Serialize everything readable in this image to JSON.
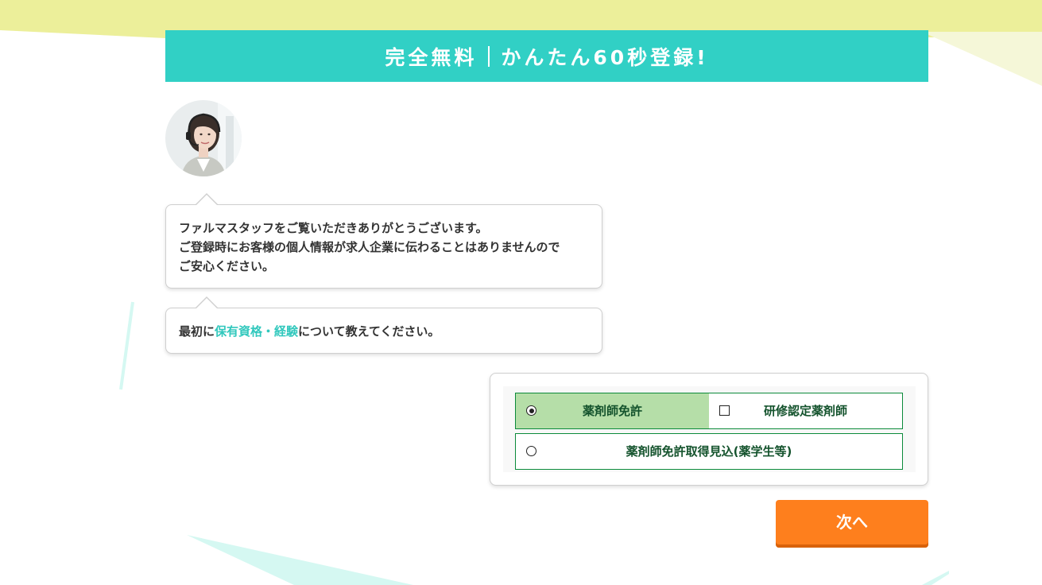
{
  "banner": {
    "part1": "完全無料",
    "part2": "かんたん60秒登録!"
  },
  "operator": {
    "avatar_alt": "オペレーター"
  },
  "messages": {
    "greeting_lines": [
      "ファルマスタッフをご覧いただきありがとうございます。",
      "ご登録時にお客様の個人情報が求人企業に伝わることはありませんので",
      "ご安心ください。"
    ],
    "question_prefix": "最初に",
    "question_highlight": "保有資格・経験",
    "question_suffix": "について教えてください。"
  },
  "options": {
    "license": {
      "label": "薬剤師免許",
      "type": "radio",
      "checked": true
    },
    "certified": {
      "label": "研修認定薬剤師",
      "type": "checkbox",
      "checked": false
    },
    "prospective": {
      "label": "薬剤師免許取得見込(薬学生等)",
      "type": "radio",
      "checked": false
    }
  },
  "next_button": {
    "label": "次へ"
  },
  "colors": {
    "banner": "#31d0c5",
    "highlight": "#31c8bd",
    "selected_option": "#b5dea8",
    "option_border": "#0b8a3a",
    "next_button": "#fe7f1d"
  }
}
